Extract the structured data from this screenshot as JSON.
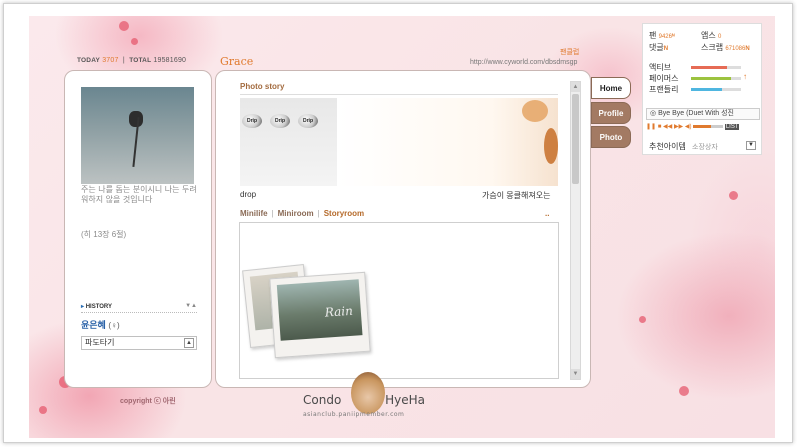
{
  "header": {
    "today_label": "TODAY",
    "today_value": "3707",
    "total_label": "TOTAL",
    "total_value": "19581690",
    "title": "Grace",
    "url": "http://www.cyworld.com/dbsdmsgp",
    "fanclub": "팬클럽"
  },
  "left": {
    "poem": "주는 나를 돕는 분이시니 나는 두려워하지 않을 것입니다",
    "episode": "(히 13장 6절)",
    "history_label": "HISTORY",
    "owner_name": "윤은혜",
    "owner_gender": "(♀)",
    "select_value": "파도타기",
    "copyright": "copyright ⓒ 아린"
  },
  "main": {
    "photo_story_title": "Photo story",
    "pin_texts": [
      "Drip",
      "Drip",
      "Drip"
    ],
    "caption_left": "drop",
    "caption_right": "가슴이 몽클해져오는",
    "tabs": [
      "Minilife",
      "Miniroom",
      "Storyroom"
    ],
    "active_tab": "Storyroom",
    "more": "..",
    "polaroid_text": "Rain"
  },
  "menu": {
    "items": [
      "Home",
      "Profile",
      "Photo"
    ]
  },
  "side": {
    "fan_label": "팬",
    "fan_value": "9426",
    "apps_label": "앱스",
    "apps_value": "0",
    "reply_label": "댓글",
    "reply_new": "N",
    "scrap_label": "스크랩",
    "scrap_value": "671086",
    "scrap_new": "N",
    "active_label": "액티브",
    "famous_label": "페이머스",
    "friendly_label": "프랜들리",
    "music_title": "Bye Bye (Duet With 성진",
    "recommend_label": "추천아이템",
    "shop_label": "소장상자"
  },
  "footer": {
    "watermark": "Condo",
    "watermark2": "HyeHa",
    "watermark_sub": "asianclub.paniipmember.com"
  },
  "colors": {
    "accent": "#e07a2e",
    "menu_active": "#a37a63",
    "name_blue": "#2a62a8"
  }
}
